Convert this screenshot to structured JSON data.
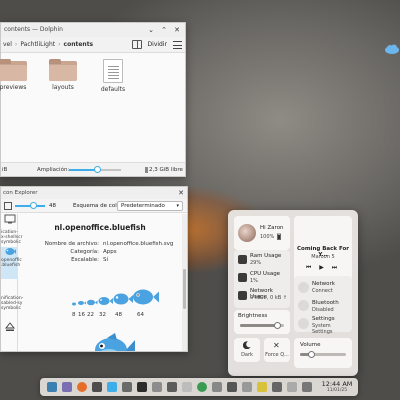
{
  "dolphin": {
    "title": "contents — Dolphin",
    "breadcrumb": [
      "vel",
      "PachtliLight",
      "contents"
    ],
    "split_label": "Dividir",
    "files": [
      {
        "name": "previews",
        "icon": "folder-icon"
      },
      {
        "name": "layouts",
        "icon": "folder-icon"
      },
      {
        "name": "defaults",
        "icon": "text-file-icon"
      }
    ],
    "status": {
      "left": "iB",
      "zoom_label": "Ampliación:",
      "zoom_fraction": 0.55,
      "free": "2,3 GiB libre"
    }
  },
  "explorer": {
    "title": "con Explorer",
    "size_value": "48",
    "size_fraction": 0.6,
    "scheme_label": "Esquema de color:",
    "scheme_value": "Predeterminado",
    "sidebar": [
      {
        "label": "",
        "selected": false
      },
      {
        "label": "ication-\nx-shellscr\nsymbolic",
        "selected": false
      },
      {
        "label": "openoffic\n.bluefish",
        "selected": true
      },
      {
        "label": "nification-\nsabled-sy\nsymbolic",
        "selected": false
      },
      {
        "label": "",
        "selected": false
      }
    ],
    "icon_name": "nl.openoffice.bluefish",
    "properties": [
      {
        "key": "Nombre de archivo:",
        "value": "nl.openoffice.bluefish.svg"
      },
      {
        "key": "Categoría:",
        "value": "Apps"
      },
      {
        "key": "Escalable:",
        "value": "Sí"
      }
    ],
    "sizes": [
      "8",
      "16",
      "22",
      "32",
      "48",
      "64"
    ]
  },
  "control_center": {
    "user": {
      "name": "Hi Zaron",
      "battery": "100%"
    },
    "media": {
      "title": "Coming Back For Y...",
      "artist": "Maroon 5",
      "controls": [
        "⏮",
        "▶",
        "⏭"
      ]
    },
    "ram": {
      "label": "Ram Usage",
      "value": "29%"
    },
    "cpu": {
      "label": "CPU Usage",
      "value": "1%"
    },
    "network_usage": {
      "label": "Network Usage",
      "value": "0 kB ↓, 0 kB ↑"
    },
    "network": {
      "label": "Network",
      "status": "Connect"
    },
    "bluetooth": {
      "label": "Bluetooth",
      "status": "Disabled"
    },
    "settings": {
      "label": "Settings",
      "status": "System Settings"
    },
    "brightness": {
      "label": "Brightness",
      "value": 0.85
    },
    "dark": {
      "label": "Dark"
    },
    "force_quit": {
      "label": "Force Q..."
    },
    "volume": {
      "label": "Volume",
      "value": 0.25
    }
  },
  "taskbar": {
    "time": "12:44 AM",
    "date": "11/01/25"
  },
  "colors": {
    "accent": "#3daee9",
    "fish_blue": "#4aa3e0"
  }
}
